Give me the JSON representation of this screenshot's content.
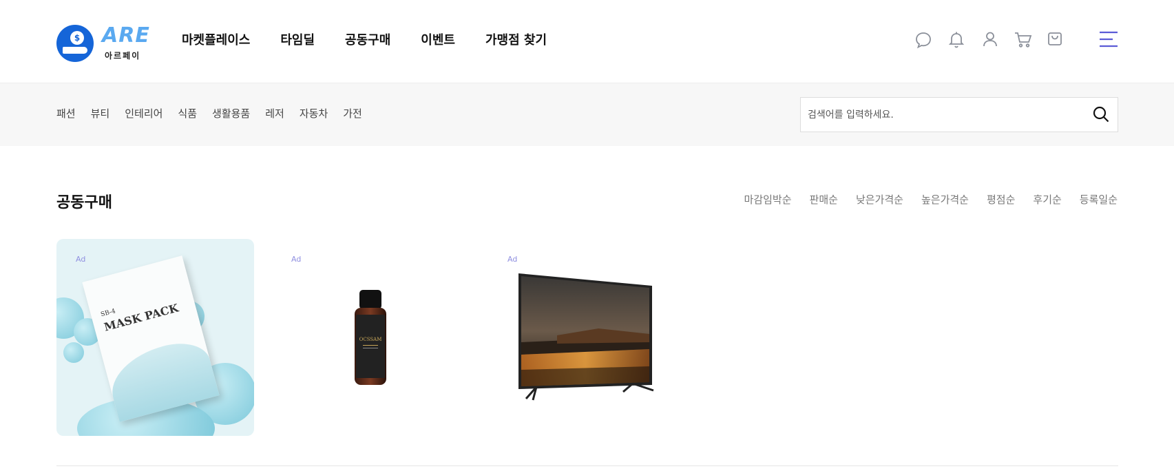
{
  "brand": {
    "name": "ARE",
    "sub": "아르페이",
    "coin_symbol": "$"
  },
  "gnb": {
    "items": [
      {
        "label": "마켓플레이스"
      },
      {
        "label": "타임딜"
      },
      {
        "label": "공동구매"
      },
      {
        "label": "이벤트"
      },
      {
        "label": "가맹점 찾기"
      }
    ]
  },
  "util_icons": [
    "chat-icon",
    "bell-icon",
    "user-icon",
    "cart-icon",
    "shopping-bag-icon",
    "menu-icon"
  ],
  "categories": [
    {
      "label": "패션"
    },
    {
      "label": "뷰티"
    },
    {
      "label": "인테리어"
    },
    {
      "label": "식품"
    },
    {
      "label": "생활용품"
    },
    {
      "label": "레저"
    },
    {
      "label": "자동차"
    },
    {
      "label": "가전"
    }
  ],
  "search": {
    "placeholder": "검색어를 입력하세요.",
    "value": ""
  },
  "section": {
    "title": "공동구매"
  },
  "sorts": [
    {
      "label": "마감임박순"
    },
    {
      "label": "판매순"
    },
    {
      "label": "낮은가격순"
    },
    {
      "label": "높은가격순"
    },
    {
      "label": "평점순"
    },
    {
      "label": "후기순"
    },
    {
      "label": "등록일순"
    }
  ],
  "products": [
    {
      "badge": "Ad",
      "image": "mask-pack",
      "pack_sub": "SB-4",
      "pack_title": "MASK PACK"
    },
    {
      "badge": "Ad",
      "image": "cosmetic-bottle",
      "bottle_label": "OCSSAM"
    },
    {
      "badge": "Ad",
      "image": "television"
    }
  ],
  "colors": {
    "brand_blue": "#1565d8",
    "logo_light_blue": "#5aa9f0",
    "menu_accent": "#5b5bd6",
    "ad_label": "#8f8fe0",
    "category_bar_bg": "#f7f7f7"
  }
}
